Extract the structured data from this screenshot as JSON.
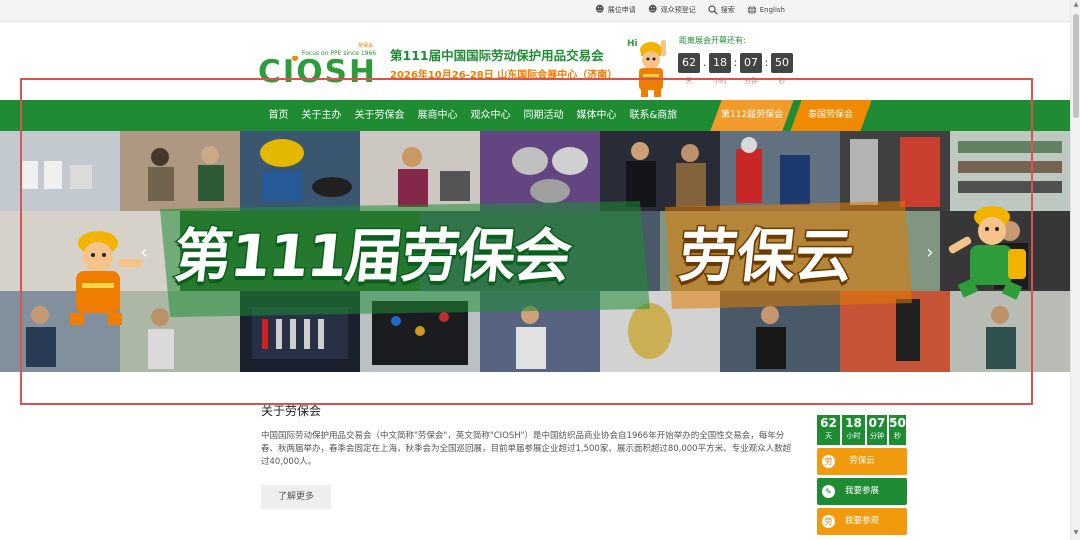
{
  "topbar": {
    "links": [
      {
        "icon": "user-icon",
        "label": "展位申请"
      },
      {
        "icon": "users-icon",
        "label": "观众预登记"
      },
      {
        "icon": "search-icon",
        "label": "搜索"
      },
      {
        "icon": "globe-icon",
        "label": "English"
      }
    ]
  },
  "header": {
    "logo_tag_top": "劳保会",
    "logo_tag": "Focus on PPE since 1966",
    "logo_text": "CIOSH",
    "title": "第111届中国国际劳动保护用品交易会",
    "date_venue": "2026年10月26-28日 山东国际会展中心（济南）",
    "countdown_label": "距离展会开幕还有:",
    "countdown": [
      {
        "value": "62",
        "unit": "天"
      },
      {
        "value": "18",
        "unit": "小时"
      },
      {
        "value": "07",
        "unit": "分钟"
      },
      {
        "value": "50",
        "unit": "秒"
      }
    ]
  },
  "nav": {
    "items": [
      "首页",
      "关于主办",
      "关于劳保会",
      "展商中心",
      "观众中心",
      "同期活动",
      "媒体中心",
      "联系&商旅"
    ],
    "highlight_a": "第112届劳保会",
    "highlight_b": "泰国劳保会"
  },
  "banner": {
    "text_left": "第111届劳保会",
    "text_right": "劳保云"
  },
  "about": {
    "title": "关于劳保会",
    "body": "中国国际劳动保护用品交易会（中文简称\"劳保会\"，英文简称\"CIOSH\"）是中国纺织品商业协会自1966年开始举办的全国性交易会，每年分春、秋两届举办，春季会固定在上海，秋季会为全国巡回展，目前单届参展企业超过1,500家、展示面积超过80,000平方米、专业观众人数超过40,000人。",
    "more_label": "了解更多"
  },
  "side": {
    "countdown": [
      {
        "value": "62",
        "unit": "天"
      },
      {
        "value": "18",
        "unit": "小时"
      },
      {
        "value": "07",
        "unit": "分钟"
      },
      {
        "value": "50",
        "unit": "秒"
      }
    ],
    "buttons": [
      {
        "label": "劳保云",
        "icon": "cloud-icon",
        "color": "#f29a0d"
      },
      {
        "label": "我要参展",
        "icon": "edit-icon",
        "color": "#1f8c34"
      },
      {
        "label": "我要参观",
        "icon": "eye-icon",
        "color": "#f29a0d"
      }
    ]
  },
  "colors": {
    "brand_green": "#1f8c34",
    "brand_orange": "#f08a00",
    "selection": "#d9534f"
  }
}
